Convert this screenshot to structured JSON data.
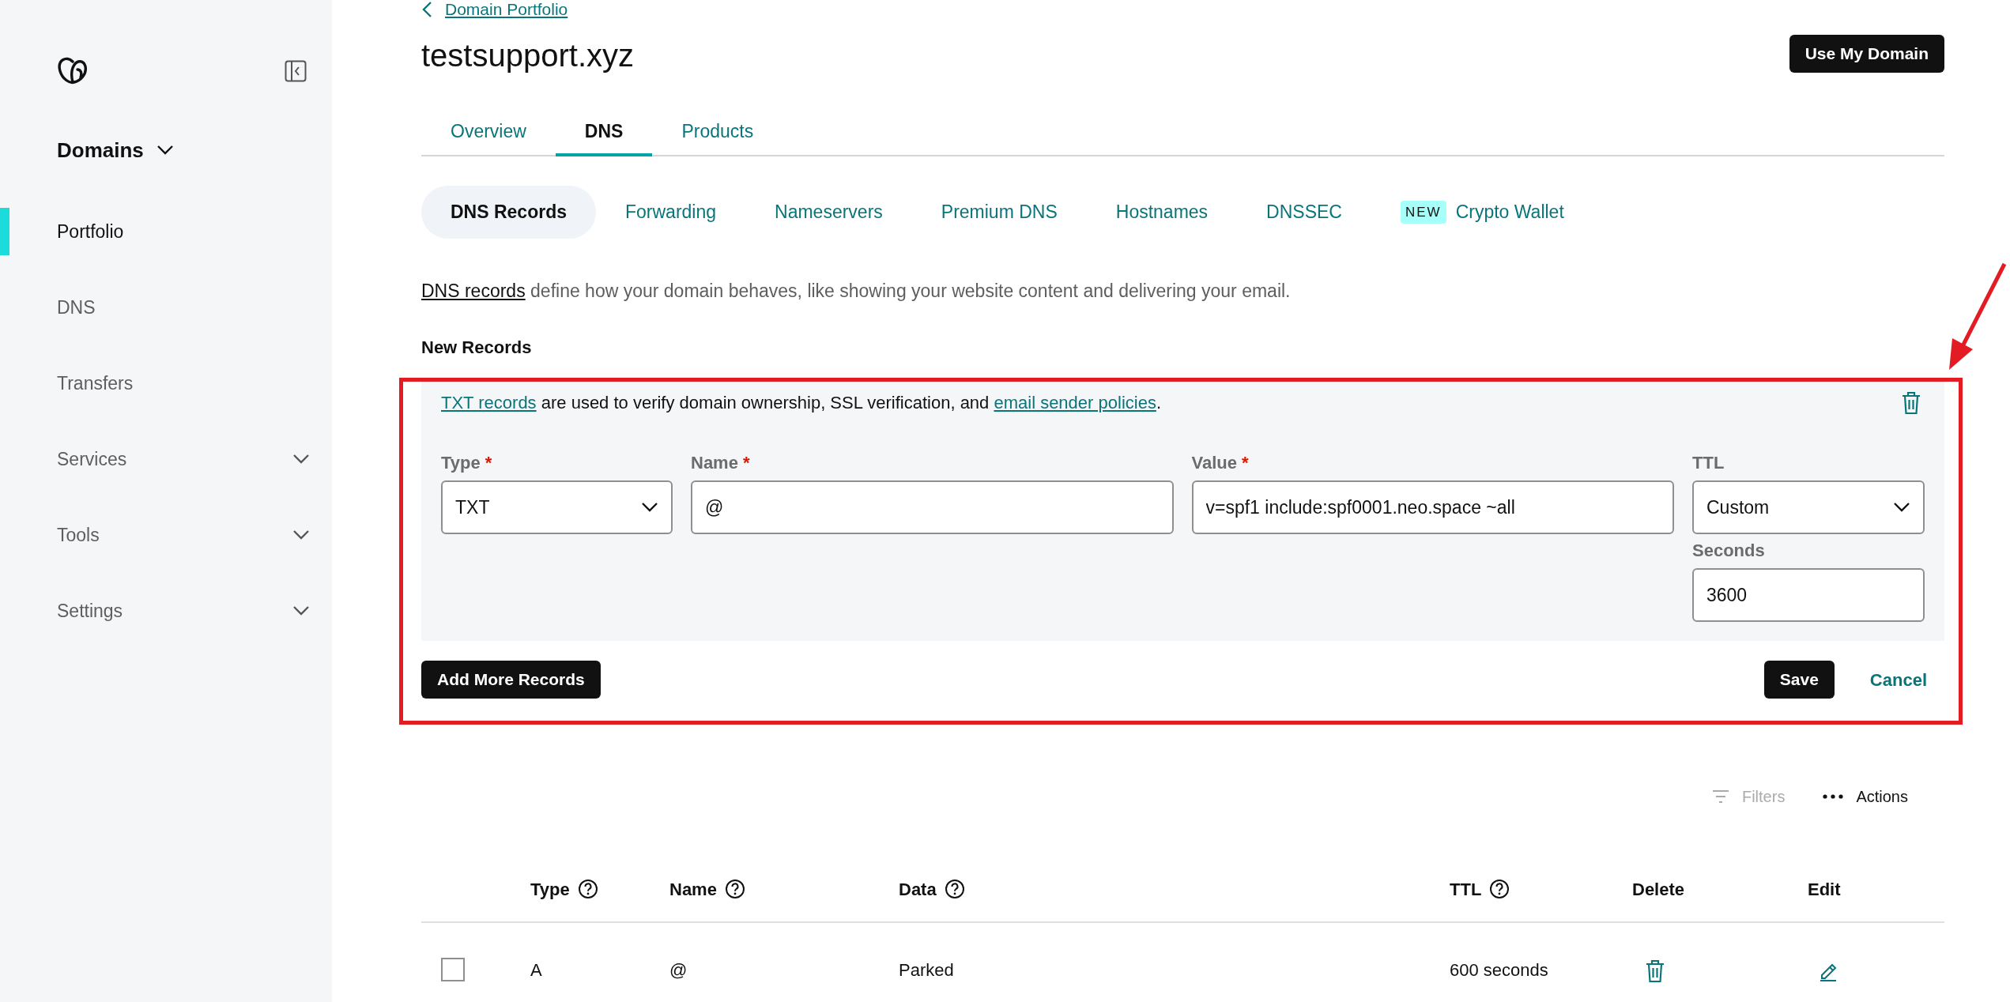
{
  "sidebar": {
    "section": {
      "label": "Domains",
      "expanded": true
    },
    "items": [
      {
        "label": "Portfolio",
        "kind": "link",
        "selected": true
      },
      {
        "label": "DNS",
        "kind": "link",
        "selected": false
      },
      {
        "label": "Transfers",
        "kind": "link",
        "selected": false
      },
      {
        "label": "Services",
        "kind": "group",
        "selected": false,
        "expanded": false
      },
      {
        "label": "Tools",
        "kind": "group",
        "selected": false,
        "expanded": false
      },
      {
        "label": "Settings",
        "kind": "group",
        "selected": false,
        "expanded": false
      }
    ]
  },
  "breadcrumb": "Domain Portfolio",
  "title": "testsupport.xyz",
  "header_button": "Use My Domain",
  "tabs": [
    {
      "label": "Overview",
      "selected": false
    },
    {
      "label": "DNS",
      "selected": true
    },
    {
      "label": "Products",
      "selected": false
    }
  ],
  "subtabs": [
    {
      "label": "DNS Records",
      "selected": true
    },
    {
      "label": "Forwarding",
      "selected": false
    },
    {
      "label": "Nameservers",
      "selected": false
    },
    {
      "label": "Premium DNS",
      "selected": false
    },
    {
      "label": "Hostnames",
      "selected": false
    },
    {
      "label": "DNSSEC",
      "selected": false
    },
    {
      "label": "Crypto Wallet",
      "selected": false,
      "badge": "NEW"
    }
  ],
  "description": [
    {
      "text": "DNS records",
      "kind": "link"
    },
    {
      "text": " define how your domain behaves, like showing your website content and delivering your email.",
      "kind": "text"
    }
  ],
  "new_records": {
    "heading": "New Records",
    "info": [
      {
        "text": "TXT records",
        "kind": "link"
      },
      {
        "text": " are used to verify domain ownership, SSL verification, and ",
        "kind": "text"
      },
      {
        "text": "email sender policies",
        "kind": "link"
      },
      {
        "text": ".",
        "kind": "text"
      }
    ],
    "fields": [
      {
        "label": "Type",
        "required_mark": "*",
        "kind": "select",
        "value": "TXT"
      },
      {
        "label": "Name",
        "required_mark": "*",
        "kind": "text",
        "value": "@"
      },
      {
        "label": "Value",
        "required_mark": "*",
        "kind": "text",
        "value": "v=spf1 include:spf0001.neo.space ~all"
      },
      {
        "label": "TTL",
        "kind": "select",
        "value": "Custom"
      }
    ],
    "seconds": {
      "label": "Seconds",
      "value": "3600"
    },
    "add_button": "Add More Records",
    "save_button": "Save",
    "cancel_button": "Cancel"
  },
  "toolbar": {
    "filters": {
      "label": "Filters",
      "disabled": true
    },
    "actions": "Actions"
  },
  "table": {
    "columns": [
      {
        "label": "Type",
        "help": true
      },
      {
        "label": "Name",
        "help": true
      },
      {
        "label": "Data",
        "help": true
      },
      {
        "label": "TTL",
        "help": true
      },
      {
        "label": "Delete",
        "help": false
      },
      {
        "label": "Edit",
        "help": false
      }
    ],
    "rows": [
      {
        "checked": false,
        "type": "A",
        "name": "@",
        "data": "Parked",
        "ttl": "600 seconds"
      }
    ]
  }
}
